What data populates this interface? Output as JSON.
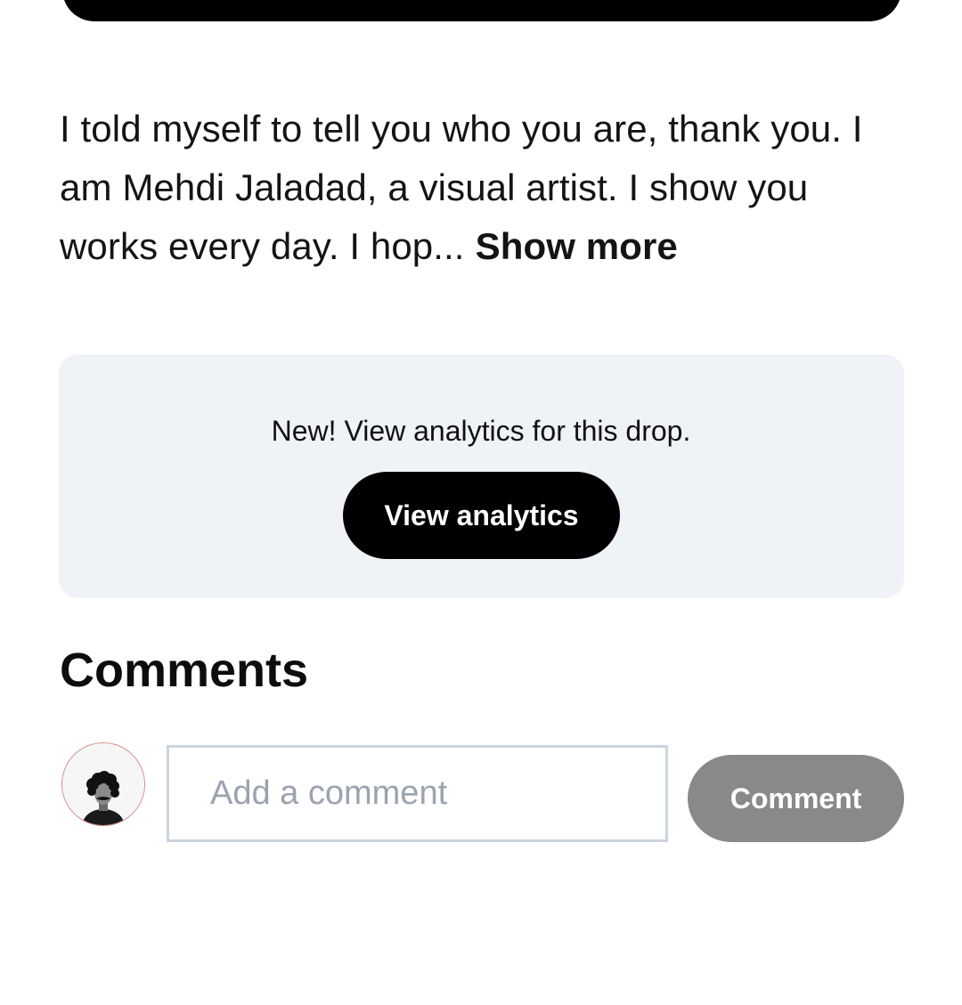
{
  "description": {
    "text": "I told myself to tell you who you are, thank you. I am Mehdi Jaladad, a visual artist. I show you works every day. I hop...",
    "show_more_label": "Show more"
  },
  "analytics": {
    "message": "New! View analytics for this drop.",
    "button_label": "View analytics"
  },
  "comments": {
    "title": "Comments",
    "input_placeholder": "Add a comment",
    "input_value": "",
    "submit_label": "Comment",
    "avatar_icon": "user-avatar-icon"
  },
  "colors": {
    "card_background": "#eff2f7",
    "primary_button": "#000000",
    "disabled_button": "#898989",
    "input_border": "#cbd5e1"
  }
}
